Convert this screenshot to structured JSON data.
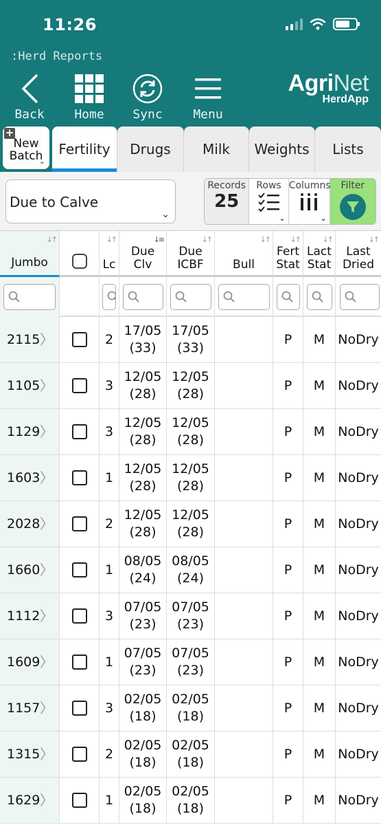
{
  "status": {
    "time": "11:26"
  },
  "app_label": ":Herd Reports",
  "nav": {
    "back": "Back",
    "home": "Home",
    "sync": "Sync",
    "menu": "Menu"
  },
  "logo": {
    "agri": "Agri",
    "net": "Net",
    "sub": "HerdApp"
  },
  "tabs": {
    "new_batch_line1": "New",
    "new_batch_line2": "Batch",
    "items": [
      "Fertility",
      "Drugs",
      "Milk",
      "Weights",
      "Lists"
    ]
  },
  "report_select": {
    "value": "Due to Calve"
  },
  "controls": {
    "records_label": "Records",
    "records_value": "25",
    "rows_label": "Rows",
    "columns_label": "Columns",
    "filter_label": "Filter"
  },
  "columns": {
    "jumbo": "Jumbo",
    "lc": "Lc",
    "due_clv_1": "Due",
    "due_clv_2": "Clv",
    "due_icbf_1": "Due",
    "due_icbf_2": "ICBF",
    "bull": "Bull",
    "fert_1": "Fert",
    "fert_2": "Stat",
    "lact_1": "Lact",
    "lact_2": "Stat",
    "last_1": "Last",
    "last_2": "Dried"
  },
  "rows": [
    {
      "jumbo": "2115",
      "lc": "2",
      "due_clv": "17/05",
      "due_clv_days": "(33)",
      "due_icbf": "17/05",
      "due_icbf_days": "(33)",
      "bull": "",
      "fert": "P",
      "lact": "M",
      "last_dried": "NoDry"
    },
    {
      "jumbo": "1105",
      "lc": "3",
      "due_clv": "12/05",
      "due_clv_days": "(28)",
      "due_icbf": "12/05",
      "due_icbf_days": "(28)",
      "bull": "",
      "fert": "P",
      "lact": "M",
      "last_dried": "NoDry"
    },
    {
      "jumbo": "1129",
      "lc": "3",
      "due_clv": "12/05",
      "due_clv_days": "(28)",
      "due_icbf": "12/05",
      "due_icbf_days": "(28)",
      "bull": "",
      "fert": "P",
      "lact": "M",
      "last_dried": "NoDry"
    },
    {
      "jumbo": "1603",
      "lc": "1",
      "due_clv": "12/05",
      "due_clv_days": "(28)",
      "due_icbf": "12/05",
      "due_icbf_days": "(28)",
      "bull": "",
      "fert": "P",
      "lact": "M",
      "last_dried": "NoDry"
    },
    {
      "jumbo": "2028",
      "lc": "2",
      "due_clv": "12/05",
      "due_clv_days": "(28)",
      "due_icbf": "12/05",
      "due_icbf_days": "(28)",
      "bull": "",
      "fert": "P",
      "lact": "M",
      "last_dried": "NoDry"
    },
    {
      "jumbo": "1660",
      "lc": "1",
      "due_clv": "08/05",
      "due_clv_days": "(24)",
      "due_icbf": "08/05",
      "due_icbf_days": "(24)",
      "bull": "",
      "fert": "P",
      "lact": "M",
      "last_dried": "NoDry"
    },
    {
      "jumbo": "1112",
      "lc": "3",
      "due_clv": "07/05",
      "due_clv_days": "(23)",
      "due_icbf": "07/05",
      "due_icbf_days": "(23)",
      "bull": "",
      "fert": "P",
      "lact": "M",
      "last_dried": "NoDry"
    },
    {
      "jumbo": "1609",
      "lc": "1",
      "due_clv": "07/05",
      "due_clv_days": "(23)",
      "due_icbf": "07/05",
      "due_icbf_days": "(23)",
      "bull": "",
      "fert": "P",
      "lact": "M",
      "last_dried": "NoDry"
    },
    {
      "jumbo": "1157",
      "lc": "3",
      "due_clv": "02/05",
      "due_clv_days": "(18)",
      "due_icbf": "02/05",
      "due_icbf_days": "(18)",
      "bull": "",
      "fert": "P",
      "lact": "M",
      "last_dried": "NoDry"
    },
    {
      "jumbo": "1315",
      "lc": "2",
      "due_clv": "02/05",
      "due_clv_days": "(18)",
      "due_icbf": "02/05",
      "due_icbf_days": "(18)",
      "bull": "",
      "fert": "P",
      "lact": "M",
      "last_dried": "NoDry"
    },
    {
      "jumbo": "1629",
      "lc": "1",
      "due_clv": "02/05",
      "due_clv_days": "(18)",
      "due_icbf": "02/05",
      "due_icbf_days": "(18)",
      "bull": "",
      "fert": "P",
      "lact": "M",
      "last_dried": "NoDry"
    }
  ],
  "colors": {
    "header_teal": "#16797a",
    "tab_active_underline": "#1a8bd8",
    "filter_green": "#9ae07d"
  }
}
